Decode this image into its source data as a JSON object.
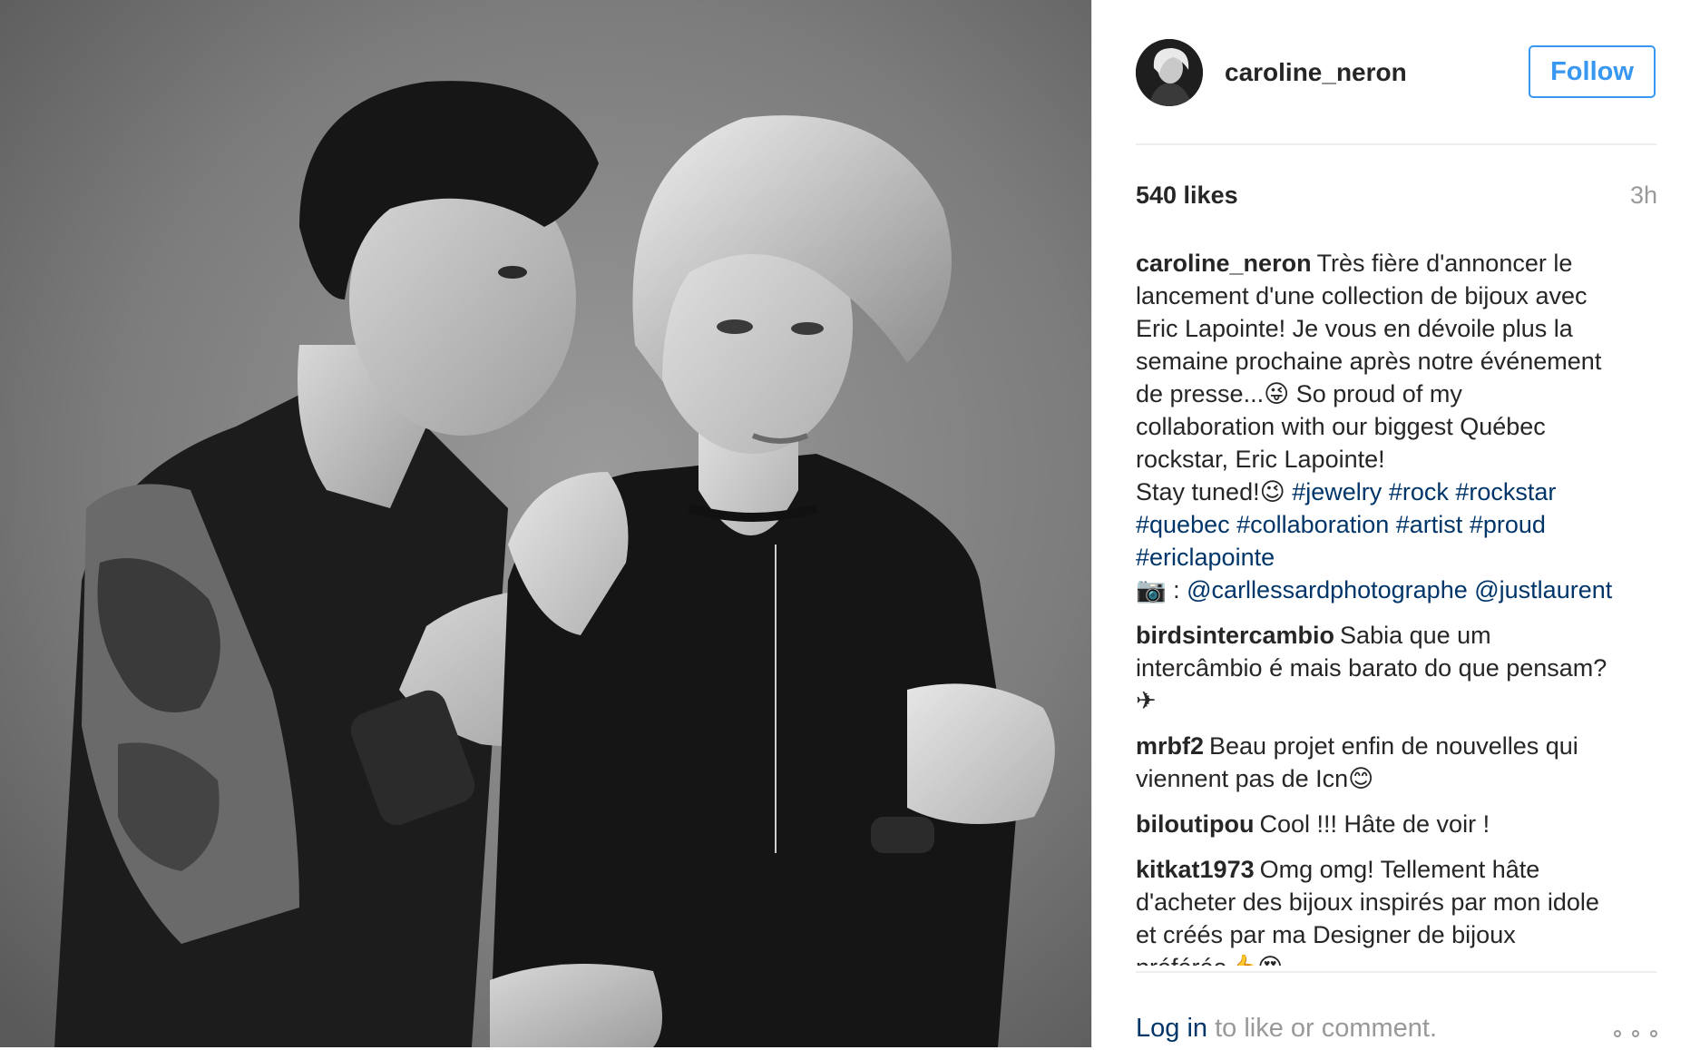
{
  "post": {
    "username": "caroline_neron",
    "follow_label": "Follow",
    "likes": "540 likes",
    "time": "3h",
    "caption": {
      "author": "caroline_neron",
      "lines": [
        "Très fière d'annoncer le",
        "lancement d'une collection de bijoux avec",
        "Eric Lapointe! Je vous en dévoile plus la",
        "semaine prochaine après notre événement",
        "de presse...😜 So proud of my",
        "collaboration with our biggest Québec",
        "rockstar, Eric Lapointe!"
      ],
      "stay_tuned": "Stay tuned!😉",
      "hashtags": [
        "#jewelry",
        "#rock",
        "#rockstar",
        "#quebec",
        "#collaboration",
        "#artist",
        "#proud",
        "#ericlapointe"
      ],
      "camera_emoji": "📷",
      "credit_sep": " : ",
      "mentions": [
        "@carllessardphotographe",
        "@justlaurent"
      ]
    },
    "comments": [
      {
        "author": "birdsintercambio",
        "lines": [
          "Sabia que um",
          "intercâmbio é mais barato do que pensam?",
          "✈"
        ]
      },
      {
        "author": "mrbf2",
        "lines": [
          "Beau projet enfin de nouvelles qui",
          "viennent pas de Icn😊"
        ]
      },
      {
        "author": "biloutipou",
        "lines": [
          "Cool !!! Hâte de voir !"
        ]
      },
      {
        "author": "kitkat1973",
        "lines": [
          "Omg omg! Tellement hâte",
          "d'acheter des bijoux inspirés par mon idole",
          "et créés par ma Designer de bijoux",
          "préférée👍😍"
        ]
      }
    ],
    "footer": {
      "login_label": "Log in",
      "rest": " to like or comment."
    }
  },
  "icons": {
    "more": "more-options-icon",
    "camera": "camera-emoji"
  },
  "colors": {
    "link_blue": "#003569",
    "follow_blue": "#3897f0",
    "muted": "#999999",
    "text": "#262626"
  }
}
